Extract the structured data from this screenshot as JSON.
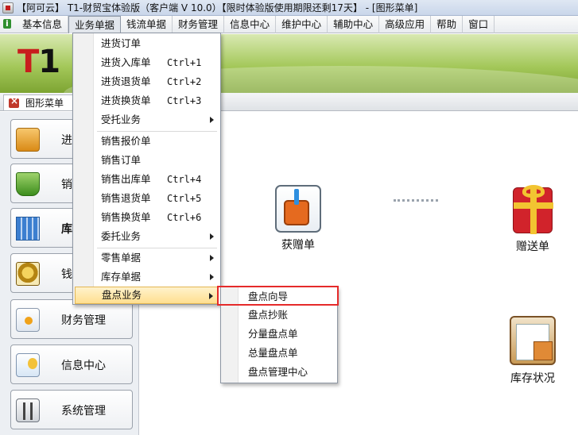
{
  "window": {
    "title": "【阿可云】 T1-财贸宝体验版（客户端 V 10.0）【限时体验版使用期限还剩17天】 - [图形菜单]"
  },
  "menubar": {
    "items": [
      "基本信息",
      "业务单据",
      "钱流单据",
      "财务管理",
      "信息中心",
      "维护中心",
      "辅助中心",
      "高级应用",
      "帮助",
      "窗口"
    ],
    "active_item": "业务单据"
  },
  "banner": {
    "logo_t": "T",
    "logo_1": "1"
  },
  "tabs": {
    "active": "图形菜单"
  },
  "sidebar": {
    "items": [
      {
        "label": "进",
        "icon": "purchase-folder-icon"
      },
      {
        "label": "销",
        "icon": "sales-basket-icon"
      },
      {
        "label": "库",
        "icon": "inventory-grid-icon"
      },
      {
        "label": "钱",
        "icon": "money-icon"
      },
      {
        "label": "财务管理",
        "icon": "finance-icon"
      },
      {
        "label": "信息中心",
        "icon": "info-bulb-icon"
      },
      {
        "label": "系统管理",
        "icon": "system-sliders-icon"
      }
    ],
    "active_index": 2
  },
  "content": {
    "items": [
      {
        "label": "获赠单",
        "icon": "receive-gift-document-icon"
      },
      {
        "label": "赠送单",
        "icon": "gift-box-icon"
      },
      {
        "label": "库存状况",
        "icon": "stock-clipboard-icon"
      }
    ]
  },
  "dropdown": {
    "items": [
      {
        "label": "进货订单",
        "shortcut": "",
        "submenu": false
      },
      {
        "label": "进货入库单",
        "shortcut": "Ctrl+1",
        "submenu": false
      },
      {
        "label": "进货退货单",
        "shortcut": "Ctrl+2",
        "submenu": false
      },
      {
        "label": "进货换货单",
        "shortcut": "Ctrl+3",
        "submenu": false
      },
      {
        "label": "受托业务",
        "shortcut": "",
        "submenu": true
      },
      {
        "label": "销售报价单",
        "shortcut": "",
        "submenu": false
      },
      {
        "label": "销售订单",
        "shortcut": "",
        "submenu": false
      },
      {
        "label": "销售出库单",
        "shortcut": "Ctrl+4",
        "submenu": false
      },
      {
        "label": "销售退货单",
        "shortcut": "Ctrl+5",
        "submenu": false
      },
      {
        "label": "销售换货单",
        "shortcut": "Ctrl+6",
        "submenu": false
      },
      {
        "label": "委托业务",
        "shortcut": "",
        "submenu": true
      },
      {
        "label": "零售单据",
        "shortcut": "",
        "submenu": true
      },
      {
        "label": "库存单据",
        "shortcut": "",
        "submenu": true
      },
      {
        "label": "盘点业务",
        "shortcut": "",
        "submenu": true
      }
    ],
    "hovered": "盘点业务"
  },
  "submenu": {
    "items": [
      "盘点向导",
      "盘点抄账",
      "分量盘点单",
      "总量盘点单",
      "盘点管理中心"
    ],
    "highlighted": "盘点向导",
    "highlight_color": "#e52a2a"
  }
}
